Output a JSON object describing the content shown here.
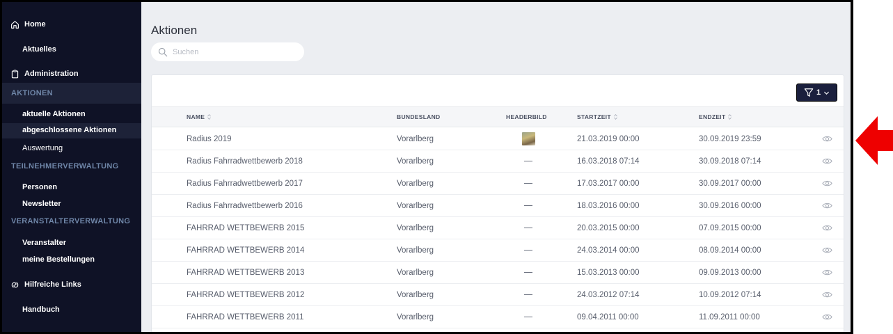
{
  "sidebar": {
    "home": "Home",
    "aktuelles": "Aktuelles",
    "administration": "Administration",
    "aktionen_section": "AKTIONEN",
    "aktuelle_aktionen": "aktuelle Aktionen",
    "abgeschlossene_aktionen": "abgeschlossene Aktionen",
    "auswertung": "Auswertung",
    "teilnehmer_section": "TEILNEHMERVERWALTUNG",
    "personen": "Personen",
    "newsletter": "Newsletter",
    "veranstalter_section": "VERANSTALTERVERWALTUNG",
    "veranstalter": "Veranstalter",
    "meine_bestellungen": "meine Bestellungen",
    "hilfreiche_links": "Hilfreiche Links",
    "handbuch": "Handbuch"
  },
  "main": {
    "title": "Aktionen",
    "search_placeholder": "Suchen",
    "filter_count": "1"
  },
  "table": {
    "headers": {
      "name": "NAME",
      "bundesland": "BUNDESLAND",
      "headerbild": "HEADERBILD",
      "startzeit": "STARTZEIT",
      "endzeit": "ENDZEIT"
    },
    "rows": [
      {
        "name": "Radius 2019",
        "bundesland": "Vorarlberg",
        "has_image": true,
        "start": "21.03.2019 00:00",
        "end": "30.09.2019 23:59"
      },
      {
        "name": "Radius Fahrradwettbewerb 2018",
        "bundesland": "Vorarlberg",
        "has_image": false,
        "start": "16.03.2018 07:14",
        "end": "30.09.2018 07:14"
      },
      {
        "name": "Radius Fahrradwettbewerb 2017",
        "bundesland": "Vorarlberg",
        "has_image": false,
        "start": "17.03.2017 00:00",
        "end": "30.09.2017 00:00"
      },
      {
        "name": "Radius Fahrradwettbewerb 2016",
        "bundesland": "Vorarlberg",
        "has_image": false,
        "start": "18.03.2016 00:00",
        "end": "30.09.2016 00:00"
      },
      {
        "name": "FAHRRAD WETTBEWERB 2015",
        "bundesland": "Vorarlberg",
        "has_image": false,
        "start": "20.03.2015 00:00",
        "end": "07.09.2015 00:00"
      },
      {
        "name": "FAHRRAD WETTBEWERB 2014",
        "bundesland": "Vorarlberg",
        "has_image": false,
        "start": "24.03.2014 00:00",
        "end": "08.09.2014 00:00"
      },
      {
        "name": "FAHRRAD WETTBEWERB 2013",
        "bundesland": "Vorarlberg",
        "has_image": false,
        "start": "15.03.2013 00:00",
        "end": "09.09.2013 00:00"
      },
      {
        "name": "FAHRRAD WETTBEWERB 2012",
        "bundesland": "Vorarlberg",
        "has_image": false,
        "start": "24.03.2012 07:14",
        "end": "10.09.2012 07:14"
      },
      {
        "name": "FAHRRAD WETTBEWERB 2011",
        "bundesland": "Vorarlberg",
        "has_image": false,
        "start": "09.04.2011 00:00",
        "end": "11.09.2011 00:00"
      }
    ]
  },
  "colors": {
    "sidebar_bg": "#0f1226",
    "annotation_arrow": "#ee0000"
  }
}
